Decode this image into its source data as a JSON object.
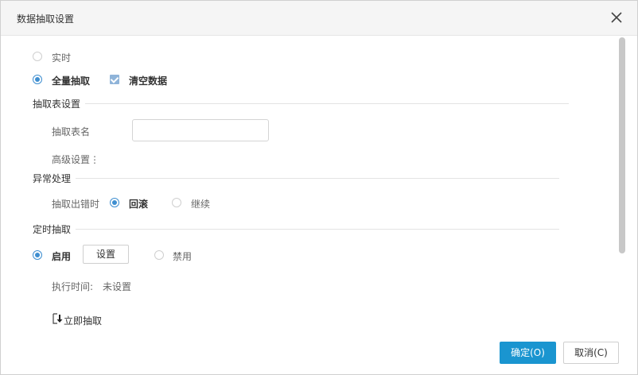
{
  "dialog": {
    "title": "数据抽取设置",
    "close_icon": "close-icon"
  },
  "mode": {
    "realtime_label": "实时",
    "realtime_selected": false,
    "full_label": "全量抽取",
    "full_selected": true,
    "clear_data_label": "清空数据",
    "clear_data_checked": true
  },
  "extract_table": {
    "section_title": "抽取表设置",
    "name_label": "抽取表名",
    "name_value": "",
    "advanced_label": "高级设置⋮"
  },
  "exception": {
    "section_title": "异常处理",
    "on_error_label": "抽取出错时",
    "rollback_label": "回滚",
    "rollback_selected": true,
    "continue_label": "继续",
    "continue_selected": false
  },
  "schedule": {
    "section_title": "定时抽取",
    "enable_label": "启用",
    "enable_selected": true,
    "settings_button": "设置",
    "disable_label": "禁用",
    "disable_selected": false,
    "exec_time_label": "执行时间:",
    "exec_time_value": "未设置"
  },
  "extract_now": {
    "icon": "extract-now-icon",
    "label": "立即抽取"
  },
  "footer": {
    "ok_button": "确定(O)",
    "cancel_button": "取消(C)"
  },
  "colors": {
    "accent": "#1a95d0",
    "radio_checked": "#3e8ed0",
    "checkbox": "#8fb4d9",
    "scrollbar": "#c8c8c8"
  }
}
